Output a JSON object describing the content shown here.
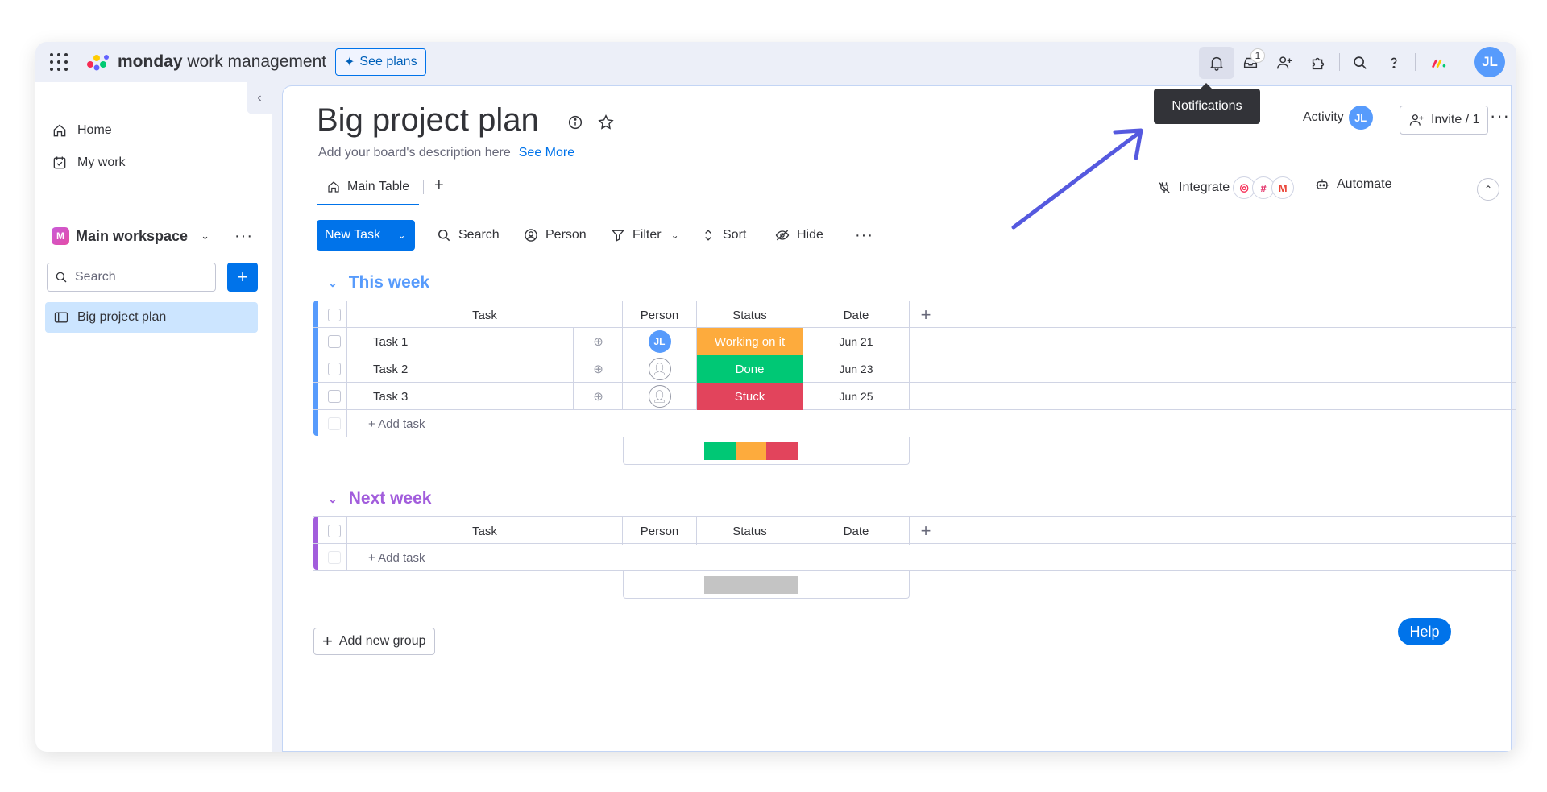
{
  "topbar": {
    "brand_bold": "monday",
    "brand_rest": " work management",
    "see_plans": "See plans",
    "inbox_badge": "1",
    "user_initials": "JL"
  },
  "tooltip": "Notifications",
  "sidebar": {
    "home": "Home",
    "my_work": "My work",
    "workspace_initial": "M",
    "workspace_name": "Main workspace",
    "search_placeholder": "Search",
    "board_name": "Big project plan"
  },
  "board": {
    "title": "Big project plan",
    "description": "Add your board's description here",
    "see_more": "See More",
    "activity": "Activity",
    "activity_initials": "JL",
    "invite": "Invite / 1",
    "tab_main": "Main Table",
    "integrate": "Integrate",
    "automate": "Automate"
  },
  "toolbar": {
    "new_task": "New Task",
    "search": "Search",
    "person": "Person",
    "filter": "Filter",
    "sort": "Sort",
    "hide": "Hide"
  },
  "columns": {
    "task": "Task",
    "person": "Person",
    "status": "Status",
    "date": "Date"
  },
  "groups": [
    {
      "title": "This week",
      "color": "#579bfc",
      "rows": [
        {
          "task": "Task 1",
          "person": "JL",
          "status": "Working on it",
          "status_color": "#fdab3d",
          "date": "Jun 21"
        },
        {
          "task": "Task 2",
          "person": "",
          "status": "Done",
          "status_color": "#00c875",
          "date": "Jun 23"
        },
        {
          "task": "Task 3",
          "person": "",
          "status": "Stuck",
          "status_color": "#e2445c",
          "date": "Jun 25"
        }
      ],
      "add_task": "+ Add task"
    },
    {
      "title": "Next week",
      "color": "#a25ddc",
      "rows": [],
      "add_task": "+ Add task"
    }
  ],
  "add_group": "Add new group",
  "help": "Help",
  "colors": {
    "primary": "#0073ea",
    "working": "#fdab3d",
    "done": "#00c875",
    "stuck": "#e2445c",
    "annotation_arrow": "#5559df"
  }
}
